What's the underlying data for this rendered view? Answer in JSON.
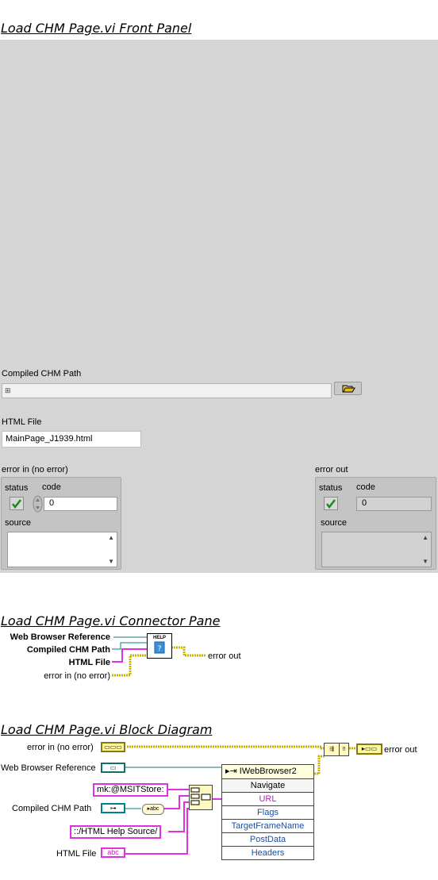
{
  "headings": {
    "front_panel": "Load CHM Page.vi Front Panel",
    "connector_pane": "Load CHM Page.vi Connector Pane",
    "block_diagram": "Load CHM Page.vi Block Diagram"
  },
  "front_panel": {
    "compiled_chm_path_label": "Compiled CHM Path",
    "compiled_chm_path_value": "",
    "html_file_label": "HTML File",
    "html_file_value": "MainPage_J1939.html",
    "error_in": {
      "label": "error in (no error)",
      "status_label": "status",
      "code_label": "code",
      "code_value": "0",
      "source_label": "source",
      "source_value": ""
    },
    "error_out": {
      "label": "error out",
      "status_label": "status",
      "code_label": "code",
      "code_value": "0",
      "source_label": "source",
      "source_value": ""
    }
  },
  "connector_pane": {
    "inputs": [
      "Web Browser Reference",
      "Compiled CHM Path",
      "HTML File",
      "error in (no error)"
    ],
    "output": "error out",
    "icon_text": "HELP"
  },
  "block_diagram": {
    "error_in_label": "error in (no error)",
    "web_browser_ref_label": "Web Browser Reference",
    "compiled_chm_path_label": "Compiled CHM Path",
    "html_file_label": "HTML File",
    "error_out_label": "error out",
    "const_mk": "mk:@MSITStore:",
    "const_source": "::/HTML Help Source/",
    "invoke": {
      "class": "IWebBrowser2",
      "method": "Navigate",
      "params": [
        "URL",
        "Flags",
        "TargetFrameName",
        "PostData",
        "Headers"
      ]
    },
    "html_file_icon": "abc"
  },
  "colors": {
    "panel_bg": "#d5d5d5",
    "string_wire": "#e030e0",
    "error_wire": "#c8b400",
    "ref_wire": "#107070",
    "path_wire": "#00808a",
    "ok_check": "#1a8a1a"
  }
}
